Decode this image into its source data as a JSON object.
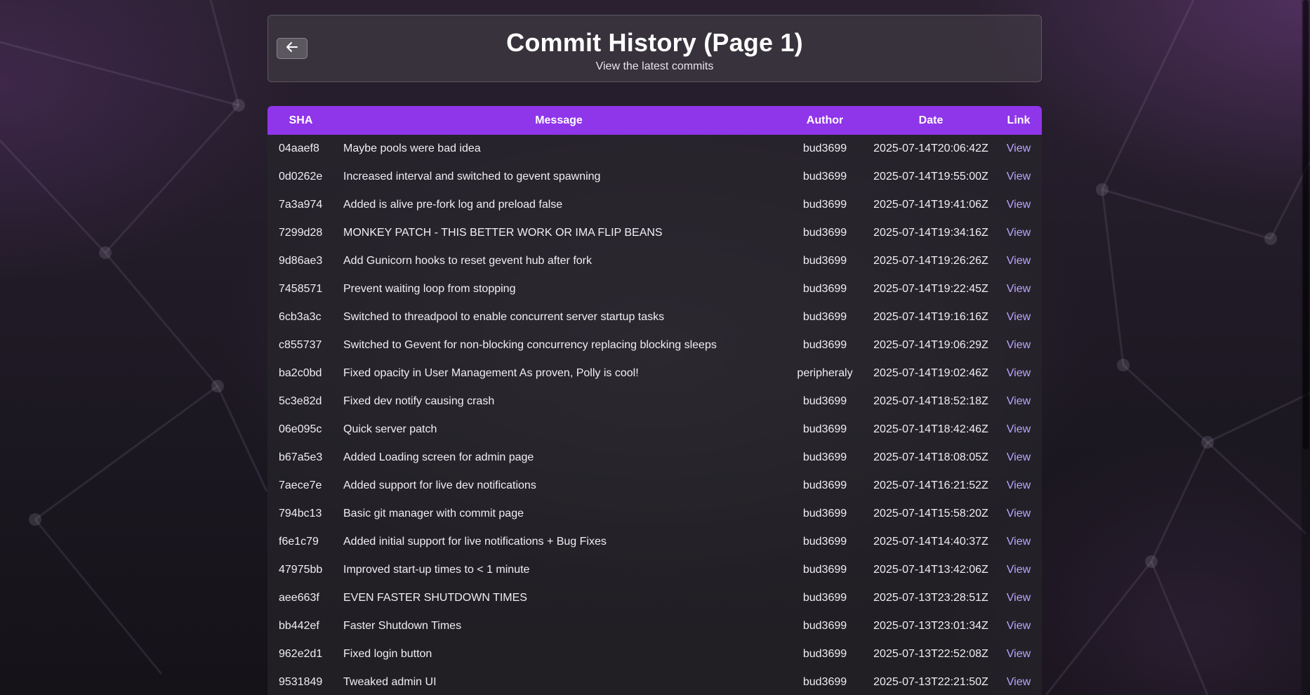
{
  "header": {
    "back_icon": "arrow-left-icon",
    "title": "Commit History (Page 1)",
    "subtitle": "View the latest commits"
  },
  "table": {
    "columns": [
      "SHA",
      "Message",
      "Author",
      "Date",
      "Link"
    ],
    "rows": [
      {
        "sha": "04aaef8",
        "message": "Maybe pools were bad idea",
        "author": "bud3699",
        "date": "2025-07-14T20:06:42Z",
        "link": "View"
      },
      {
        "sha": "0d0262e",
        "message": "Increased interval and switched to gevent spawning",
        "author": "bud3699",
        "date": "2025-07-14T19:55:00Z",
        "link": "View"
      },
      {
        "sha": "7a3a974",
        "message": "Added is alive pre-fork log and preload false",
        "author": "bud3699",
        "date": "2025-07-14T19:41:06Z",
        "link": "View"
      },
      {
        "sha": "7299d28",
        "message": "MONKEY PATCH - THIS BETTER WORK OR IMA FLIP BEANS",
        "author": "bud3699",
        "date": "2025-07-14T19:34:16Z",
        "link": "View"
      },
      {
        "sha": "9d86ae3",
        "message": "Add Gunicorn hooks to reset gevent hub after fork",
        "author": "bud3699",
        "date": "2025-07-14T19:26:26Z",
        "link": "View"
      },
      {
        "sha": "7458571",
        "message": "Prevent waiting loop from stopping",
        "author": "bud3699",
        "date": "2025-07-14T19:22:45Z",
        "link": "View"
      },
      {
        "sha": "6cb3a3c",
        "message": "Switched to threadpool to enable concurrent server startup tasks",
        "author": "bud3699",
        "date": "2025-07-14T19:16:16Z",
        "link": "View"
      },
      {
        "sha": "c855737",
        "message": "Switched to Gevent for non-blocking concurrency replacing blocking sleeps",
        "author": "bud3699",
        "date": "2025-07-14T19:06:29Z",
        "link": "View"
      },
      {
        "sha": "ba2c0bd",
        "message": "Fixed opacity in User Management As proven, Polly is cool!",
        "author": "peripheraly",
        "date": "2025-07-14T19:02:46Z",
        "link": "View"
      },
      {
        "sha": "5c3e82d",
        "message": "Fixed dev notify causing crash",
        "author": "bud3699",
        "date": "2025-07-14T18:52:18Z",
        "link": "View"
      },
      {
        "sha": "06e095c",
        "message": "Quick server patch",
        "author": "bud3699",
        "date": "2025-07-14T18:42:46Z",
        "link": "View"
      },
      {
        "sha": "b67a5e3",
        "message": "Added Loading screen for admin page",
        "author": "bud3699",
        "date": "2025-07-14T18:08:05Z",
        "link": "View"
      },
      {
        "sha": "7aece7e",
        "message": "Added support for live dev notifications",
        "author": "bud3699",
        "date": "2025-07-14T16:21:52Z",
        "link": "View"
      },
      {
        "sha": "794bc13",
        "message": "Basic git manager with commit page",
        "author": "bud3699",
        "date": "2025-07-14T15:58:20Z",
        "link": "View"
      },
      {
        "sha": "f6e1c79",
        "message": "Added initial support for live notifications + Bug Fixes",
        "author": "bud3699",
        "date": "2025-07-14T14:40:37Z",
        "link": "View"
      },
      {
        "sha": "47975bb",
        "message": "Improved start-up times to < 1 minute",
        "author": "bud3699",
        "date": "2025-07-14T13:42:06Z",
        "link": "View"
      },
      {
        "sha": "aee663f",
        "message": "EVEN FASTER SHUTDOWN TIMES",
        "author": "bud3699",
        "date": "2025-07-13T23:28:51Z",
        "link": "View"
      },
      {
        "sha": "bb442ef",
        "message": "Faster Shutdown Times",
        "author": "bud3699",
        "date": "2025-07-13T23:01:34Z",
        "link": "View"
      },
      {
        "sha": "962e2d1",
        "message": "Fixed login button",
        "author": "bud3699",
        "date": "2025-07-13T22:52:08Z",
        "link": "View"
      },
      {
        "sha": "9531849",
        "message": "Tweaked admin UI",
        "author": "bud3699",
        "date": "2025-07-13T22:21:50Z",
        "link": "View"
      }
    ]
  },
  "colors": {
    "header_accent": "#8f35ea",
    "link": "#b9a6ff",
    "text": "#f1eef3"
  }
}
